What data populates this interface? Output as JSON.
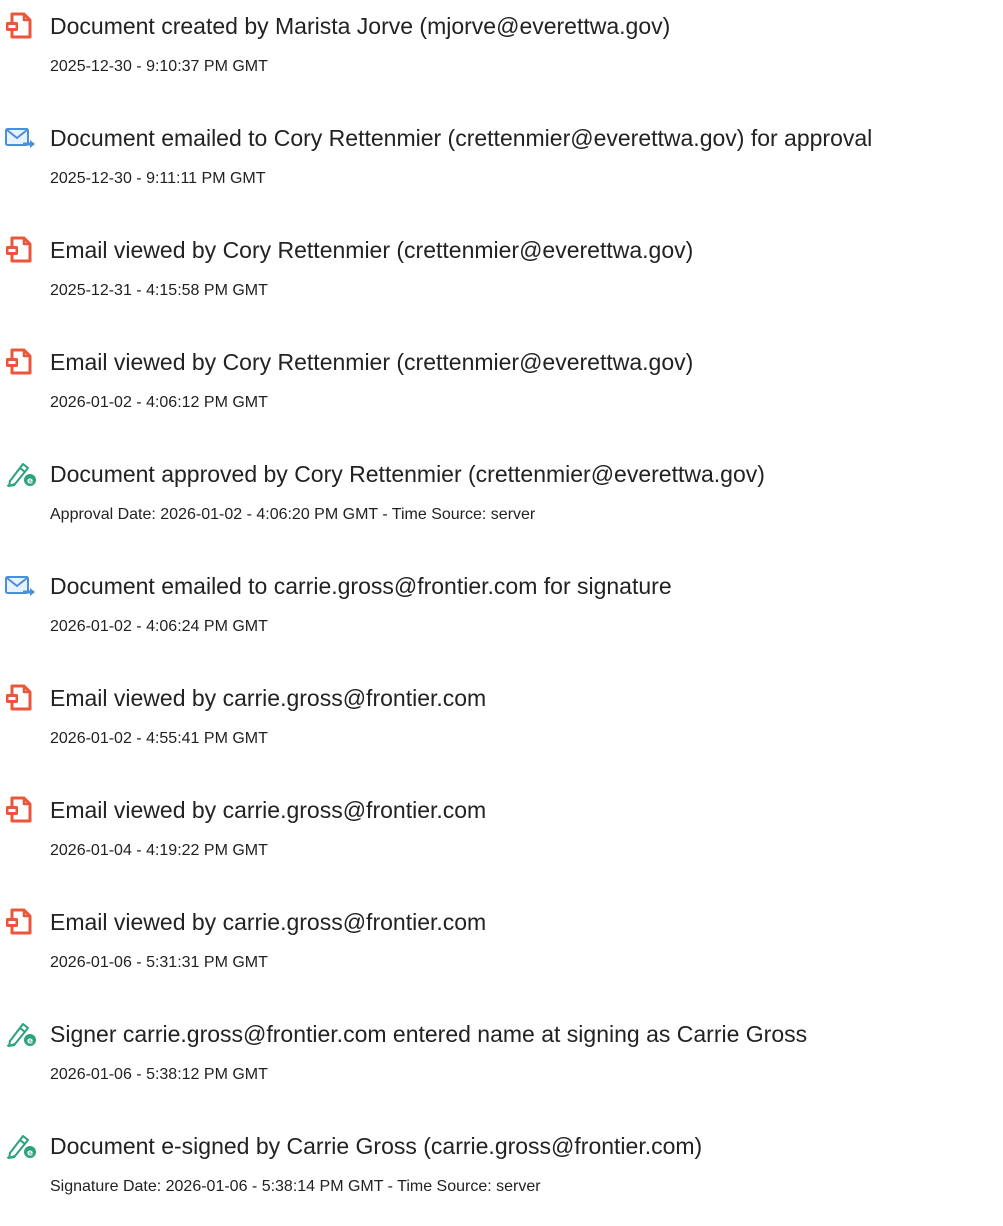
{
  "colors": {
    "doc_icon": "#e8573b",
    "mail_icon": "#4a90d9",
    "sign_icon": "#2aa37a",
    "text": "#222222"
  },
  "entries": [
    {
      "icon": "document-icon",
      "title": "Document created by Marista Jorve (mjorve@everettwa.gov)",
      "detail": "2025-12-30 - 9:10:37 PM GMT"
    },
    {
      "icon": "email-sent-icon",
      "title": "Document emailed to Cory Rettenmier (crettenmier@everettwa.gov) for approval",
      "detail": "2025-12-30 - 9:11:11 PM GMT"
    },
    {
      "icon": "document-icon",
      "title": "Email viewed by Cory Rettenmier (crettenmier@everettwa.gov)",
      "detail": "2025-12-31 - 4:15:58 PM GMT"
    },
    {
      "icon": "document-icon",
      "title": "Email viewed by Cory Rettenmier (crettenmier@everettwa.gov)",
      "detail": "2026-01-02 - 4:06:12 PM GMT"
    },
    {
      "icon": "esign-pen-icon",
      "title": "Document approved by Cory Rettenmier (crettenmier@everettwa.gov)",
      "detail": "Approval Date: 2026-01-02 - 4:06:20 PM GMT - Time Source: server"
    },
    {
      "icon": "email-sent-icon",
      "title": "Document emailed to carrie.gross@frontier.com for signature",
      "detail": "2026-01-02 - 4:06:24 PM GMT"
    },
    {
      "icon": "document-icon",
      "title": "Email viewed by carrie.gross@frontier.com",
      "detail": "2026-01-02 - 4:55:41 PM GMT"
    },
    {
      "icon": "document-icon",
      "title": "Email viewed by carrie.gross@frontier.com",
      "detail": "2026-01-04 - 4:19:22 PM GMT"
    },
    {
      "icon": "document-icon",
      "title": "Email viewed by carrie.gross@frontier.com",
      "detail": "2026-01-06 - 5:31:31 PM GMT"
    },
    {
      "icon": "esign-pen-icon",
      "title": "Signer carrie.gross@frontier.com entered name at signing as Carrie Gross",
      "detail": "2026-01-06 - 5:38:12 PM GMT"
    },
    {
      "icon": "esign-pen-icon",
      "title": "Document e-signed by Carrie Gross (carrie.gross@frontier.com)",
      "detail": "Signature Date: 2026-01-06 - 5:38:14 PM GMT - Time Source: server"
    }
  ]
}
